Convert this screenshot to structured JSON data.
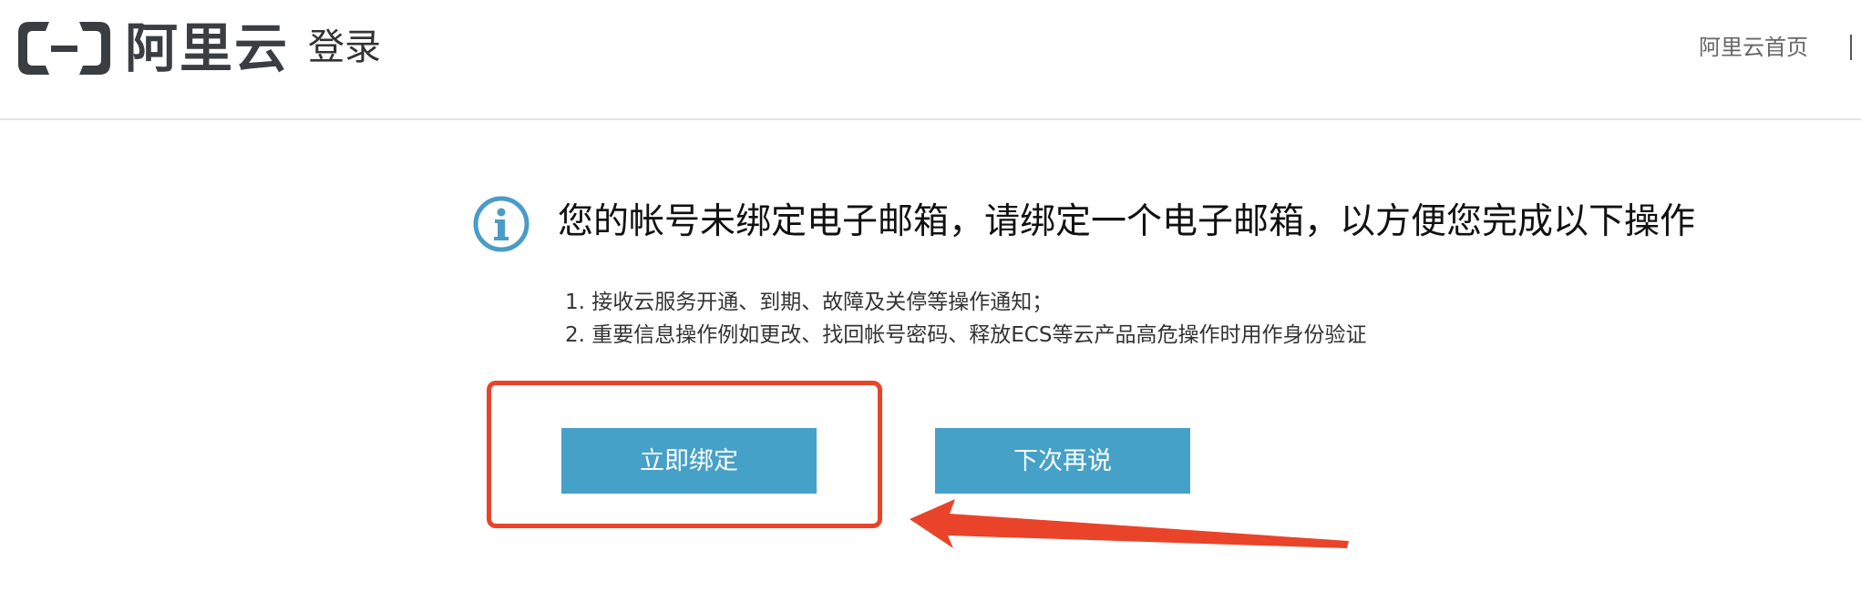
{
  "header": {
    "logo_text": "阿里云",
    "page_label": "登录",
    "home_link": "阿里云首页"
  },
  "notice": {
    "icon": "info-icon",
    "title": "您的帐号未绑定电子邮箱，请绑定一个电子邮箱，以方便您完成以下操作",
    "items": [
      "1. 接收云服务开通、到期、故障及关停等操作通知；",
      "2. 重要信息操作例如更改、找回帐号密码、释放ECS等云产品高危操作时用作身份验证"
    ]
  },
  "actions": {
    "bind_now": "立即绑定",
    "later": "下次再说"
  },
  "colors": {
    "button": "#46a1c8",
    "icon": "#4a9cc7",
    "annotation": "#e94429",
    "logo": "#3a3d42"
  }
}
